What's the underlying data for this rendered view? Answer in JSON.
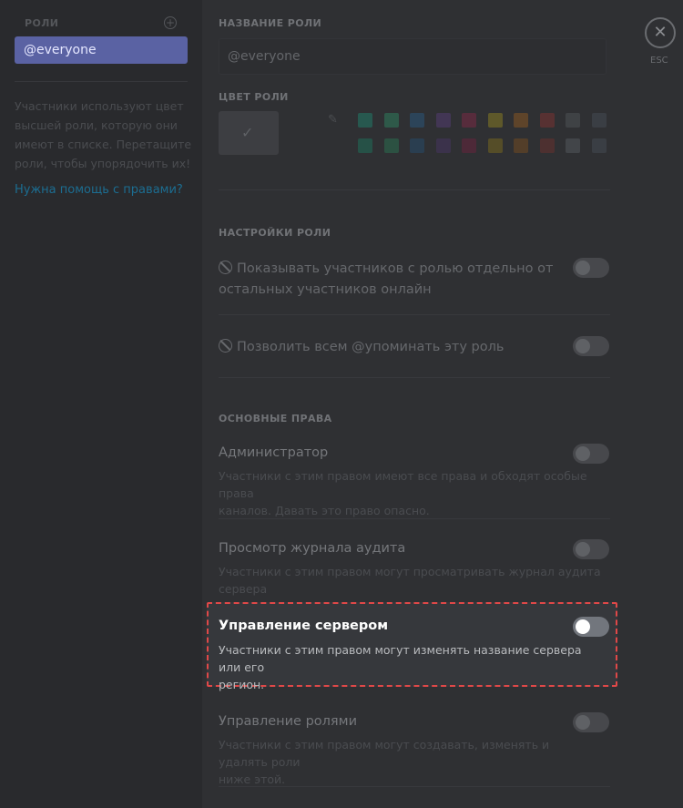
{
  "sidebar": {
    "header": "РОЛИ",
    "roles": [
      {
        "label": "@everyone"
      }
    ],
    "description": "Участники используют цвет высшей роли, которую они имеют в списке. Перетащите роли, чтобы упорядочить их!",
    "help_link": "Нужна помощь с правами?"
  },
  "role_name": {
    "label": "НАЗВАНИЕ РОЛИ",
    "value": "@everyone"
  },
  "role_color": {
    "label": "ЦВЕТ РОЛИ",
    "swatches_row1": [
      "#1f8a70",
      "#2e8b63",
      "#2a5e87",
      "#5a3f7d",
      "#8a2748",
      "#9a8a1f",
      "#9a5e1f",
      "#8a3330",
      "#55585c",
      "#4a5058"
    ],
    "swatches_row2": [
      "#1d7a5f",
      "#2a7a55",
      "#254f73",
      "#4c3669",
      "#74213e",
      "#86701b",
      "#80501c",
      "#74302c",
      "#5c5f63",
      "#495058"
    ]
  },
  "role_settings": {
    "label": "НАСТРОЙКИ РОЛИ",
    "items": [
      {
        "line1": "Показывать участников с ролью отдельно от",
        "line2": "остальных участников онлайн"
      },
      {
        "line1": "Позволить всем @упоминать эту роль"
      }
    ]
  },
  "permissions": {
    "label": "ОСНОВНЫЕ ПРАВА",
    "items": [
      {
        "title": "Администратор",
        "desc1": "Участники с этим правом имеют все права и обходят особые права",
        "desc2": "каналов. Давать это право опасно."
      },
      {
        "title": "Просмотр журнала аудита",
        "desc1": "Участники с этим правом могут просматривать журнал аудита сервера"
      },
      {
        "title": "Управление сервером",
        "desc1": "Участники с этим правом могут изменять название сервера или его",
        "desc2": "регион."
      },
      {
        "title": "Управление ролями",
        "desc1": "Участники с этим правом могут создавать, изменять и удалять роли",
        "desc2": "ниже этой."
      }
    ]
  },
  "close": {
    "label": "ESC"
  }
}
